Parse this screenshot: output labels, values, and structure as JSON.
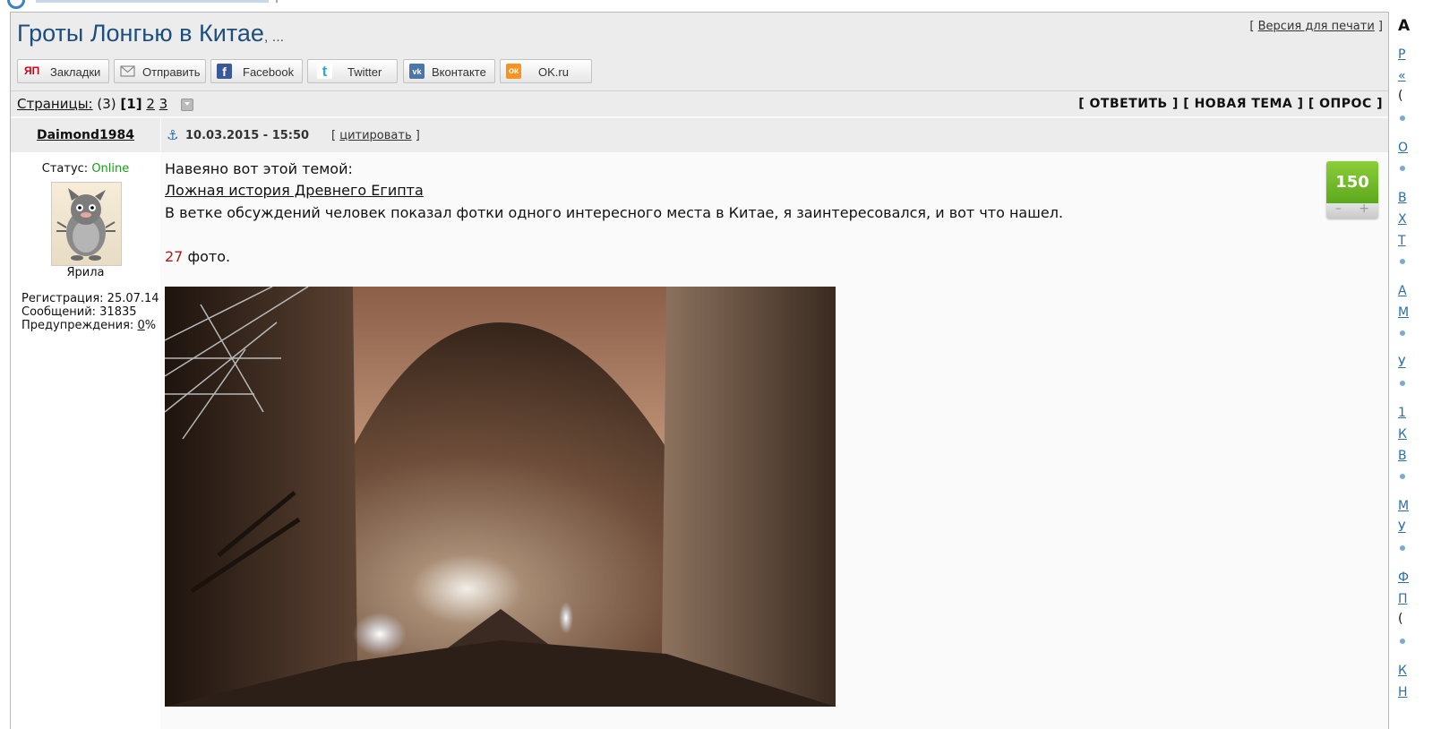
{
  "page": {
    "title": "Гроты Лонгью в Китае",
    "title_suffix": ", ...",
    "print_version": "Версия для печати"
  },
  "share": {
    "buttons": [
      {
        "label": "Закладки",
        "icon": "yandex-bookmarks-icon",
        "icon_text": "ЯП",
        "color": "#d0021b"
      },
      {
        "label": "Отправить",
        "icon": "envelope-icon",
        "color": "#888888"
      },
      {
        "label": "Facebook",
        "icon": "facebook-icon",
        "icon_text": "f",
        "color": "#3b5998"
      },
      {
        "label": "Twitter",
        "icon": "twitter-icon",
        "icon_text": "t",
        "color": "#2fa8d8"
      },
      {
        "label": "Вконтакте",
        "icon": "vk-icon",
        "icon_text": "vk",
        "color": "#4a76a8"
      },
      {
        "label": "OK.ru",
        "icon": "odnoklassniki-icon",
        "icon_text": "ок",
        "color": "#f7931e"
      }
    ]
  },
  "pagination": {
    "label": "Страницы:",
    "count": "(3)",
    "current": "[1]",
    "pages": [
      "2",
      "3"
    ]
  },
  "actions": "[ ОТВЕТИТЬ ] [ НОВАЯ ТЕМА ] [ ОПРОС ]",
  "post": {
    "author": "Daimond1984",
    "status_label": "Статус:",
    "status_value": "Online",
    "avatar_caption": "Ярила",
    "registration": "Регистрация: 25.07.14",
    "messages": "Сообщений: 31835",
    "warnings_label": "Предупреждения:",
    "warnings_value": "0",
    "warnings_suffix": "%",
    "date": "10.03.2015 - 15:50",
    "quote": "цитировать",
    "line1": "Навеяно вот этой темой:",
    "link": "Ложная история Древнего Египта",
    "line2": "В ветке обсуждений человек показал фотки одного интересного места в Китае, я заинтересовался, и вот что нашел.",
    "photo_count": "27",
    "photo_word": "фото.",
    "rating": "150",
    "rating_minus": "–",
    "rating_plus": "+"
  },
  "right_sidebar": {
    "heading": "А",
    "items": [
      "Р",
      "«",
      "(",
      "О",
      "В",
      "Х",
      "Т",
      "А",
      "М",
      "У",
      "1",
      "К",
      "В",
      "М",
      "У",
      "Ф",
      "П",
      "(",
      "К",
      "Н"
    ]
  },
  "colors": {
    "title": "#1e4e7e",
    "online": "#1a9a1a",
    "rating_bg": "#6fbb27",
    "photo_count": "#b21818"
  }
}
